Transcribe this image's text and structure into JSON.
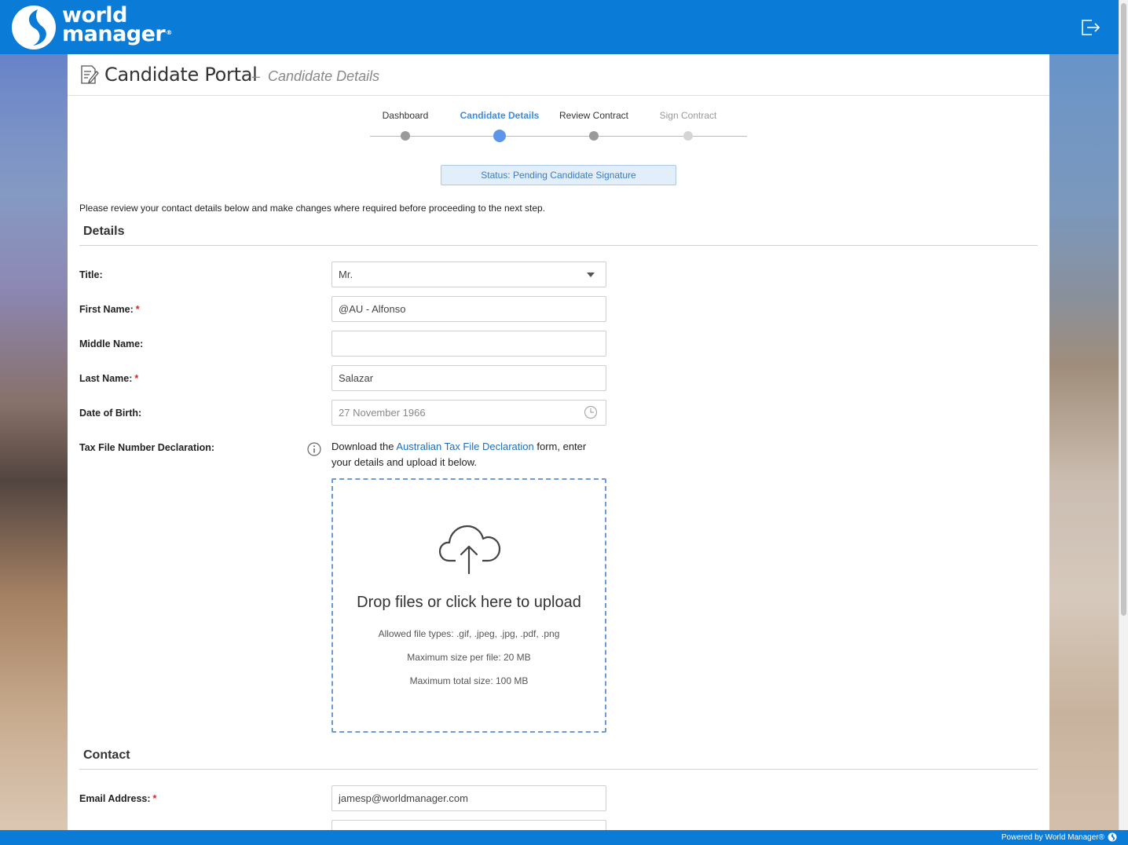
{
  "brand": {
    "name_line1": "world",
    "name_line2": "manager",
    "reg": "®"
  },
  "header": {
    "title": "Candidate Portal",
    "separator": "–",
    "subtitle": "Candidate Details"
  },
  "steps": [
    {
      "label": "Dashboard",
      "state": "done"
    },
    {
      "label": "Candidate Details",
      "state": "active"
    },
    {
      "label": "Review Contract",
      "state": "done"
    },
    {
      "label": "Sign Contract",
      "state": "future"
    }
  ],
  "status": "Status: Pending Candidate Signature",
  "intro": "Please review your contact details below and make changes where required before proceeding to the next step.",
  "details": {
    "section_title": "Details",
    "title_label": "Title:",
    "title_value": "Mr.",
    "first_name_label": "First Name:",
    "first_name_value": "@AU - Alfonso",
    "middle_name_label": "Middle Name:",
    "middle_name_value": "",
    "last_name_label": "Last Name:",
    "last_name_value": "Salazar",
    "dob_label": "Date of Birth:",
    "dob_value": "27 November 1966",
    "tfn_label": "Tax File Number Declaration:",
    "tfn_text_before": "Download the ",
    "tfn_link": "Australian Tax File Declaration",
    "tfn_text_after": " form, enter your details and upload it below.",
    "required_mark": "*"
  },
  "upload": {
    "title": "Drop files or click here to upload",
    "allowed": "Allowed file types: .gif, .jpeg, .jpg, .pdf, .png",
    "max_file": "Maximum size per file: 20 MB",
    "max_total": "Maximum total size: 100 MB"
  },
  "contact": {
    "section_title": "Contact",
    "email_label": "Email Address:",
    "email_value": "jamesp@worldmanager.com"
  },
  "footer": {
    "powered_by": "Powered by World Manager®"
  },
  "colors": {
    "brand_blue": "#0a7bd6",
    "accent": "#5b96ea",
    "required": "#d9232b"
  }
}
